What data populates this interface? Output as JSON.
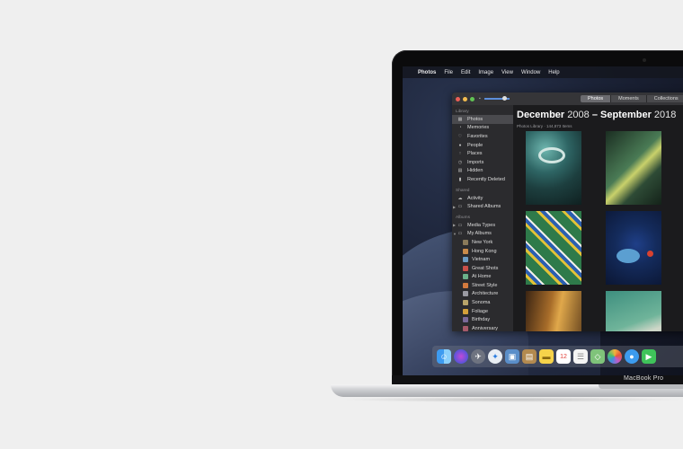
{
  "menubar": {
    "apple_icon": "apple-icon",
    "app_name": "Photos",
    "items": [
      "File",
      "Edit",
      "Image",
      "View",
      "Window",
      "Help"
    ]
  },
  "window": {
    "tabs": [
      "Photos",
      "Moments",
      "Collections"
    ],
    "active_tab": "Photos",
    "sidebar": {
      "library_label": "Library",
      "library_items": [
        "Photos",
        "Memories",
        "Favorites",
        "People",
        "Places",
        "Imports",
        "Hidden",
        "Recently Deleted"
      ],
      "shared_label": "Shared",
      "shared_items": [
        "Activity",
        "Shared Albums"
      ],
      "albums_label": "Albums",
      "album_groups": [
        "Media Types",
        "My Albums"
      ],
      "my_albums": [
        "New York",
        "Hong Kong",
        "Vietnam",
        "Great Shots",
        "At Home",
        "Street Style",
        "Architecture",
        "Sonoma",
        "Foliage",
        "Birthday",
        "Anniversary"
      ]
    },
    "content": {
      "title_month_start": "December",
      "title_year_start": "2008",
      "title_dash": "–",
      "title_month_end": "September",
      "title_year_end": "2018",
      "subtitle": "Photos Library · 144,873 Items"
    }
  },
  "dock": {
    "icons": [
      "finder-icon",
      "siri-icon",
      "launchpad-icon",
      "safari-icon",
      "preview-icon",
      "notefile-icon",
      "notes-icon",
      "calendar-icon",
      "reminders-icon",
      "maps-icon",
      "photos-icon",
      "messages-icon",
      "facetime-icon"
    ],
    "calendar_day": "12"
  },
  "device": {
    "label": "MacBook Pro"
  },
  "colors": {
    "background": "#efefef",
    "window": "#1e1e20",
    "sidebar": "#2b2b2e",
    "accent": "#5c8edb"
  }
}
